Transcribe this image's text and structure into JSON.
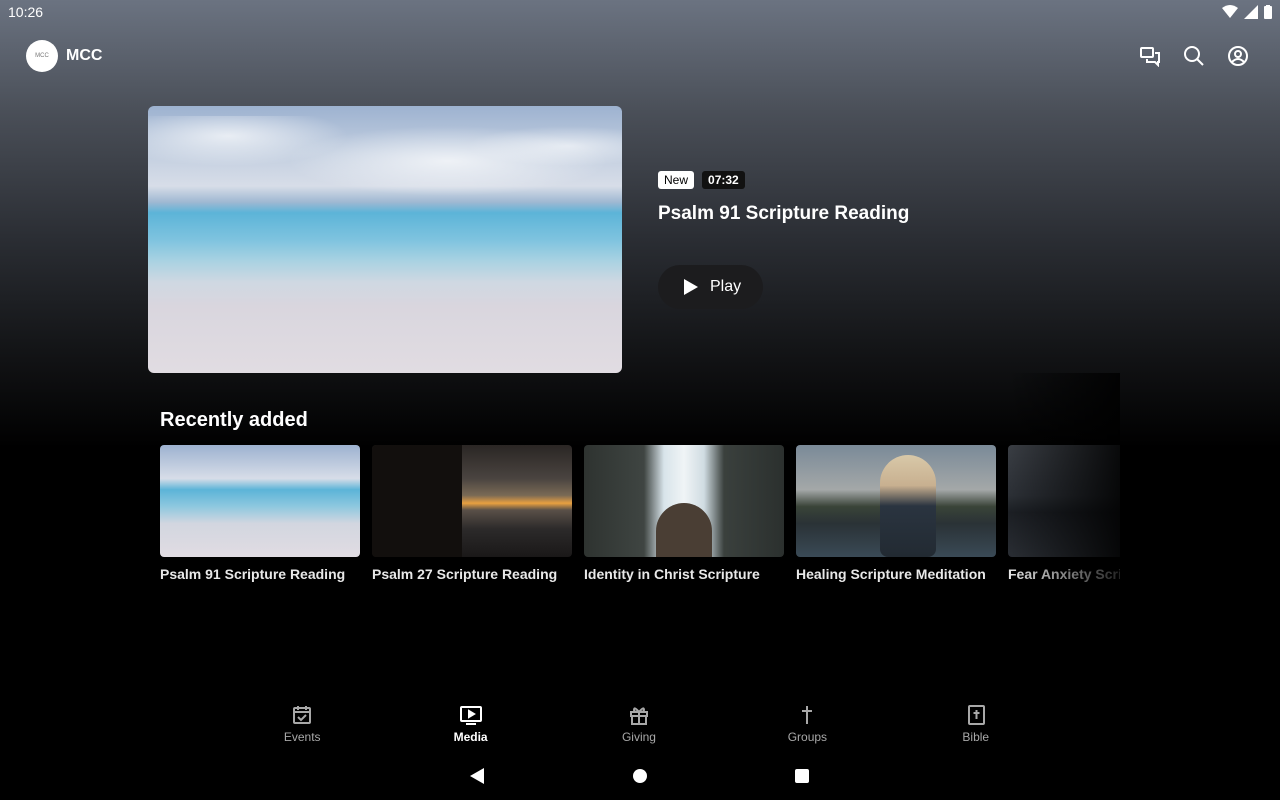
{
  "status_bar": {
    "time": "10:26"
  },
  "header": {
    "logo_text": "MCC",
    "app_name": "MCC"
  },
  "hero": {
    "badge_new": "New",
    "duration": "07:32",
    "title": "Psalm 91 Scripture Reading",
    "play_label": "Play"
  },
  "recently_added": {
    "title": "Recently added",
    "items": [
      {
        "title": "Psalm 91 Scripture Reading"
      },
      {
        "title": "Psalm 27 Scripture Reading"
      },
      {
        "title": "Identity in Christ Scripture"
      },
      {
        "title": "Healing Scripture Meditation"
      },
      {
        "title": "Fear Anxiety Scripture"
      }
    ]
  },
  "bottom_nav": {
    "items": [
      {
        "label": "Events",
        "icon": "calendar-check-icon"
      },
      {
        "label": "Media",
        "icon": "tv-play-icon"
      },
      {
        "label": "Giving",
        "icon": "gift-icon"
      },
      {
        "label": "Groups",
        "icon": "cross-icon"
      },
      {
        "label": "Bible",
        "icon": "bible-icon"
      }
    ],
    "active": "Media"
  }
}
